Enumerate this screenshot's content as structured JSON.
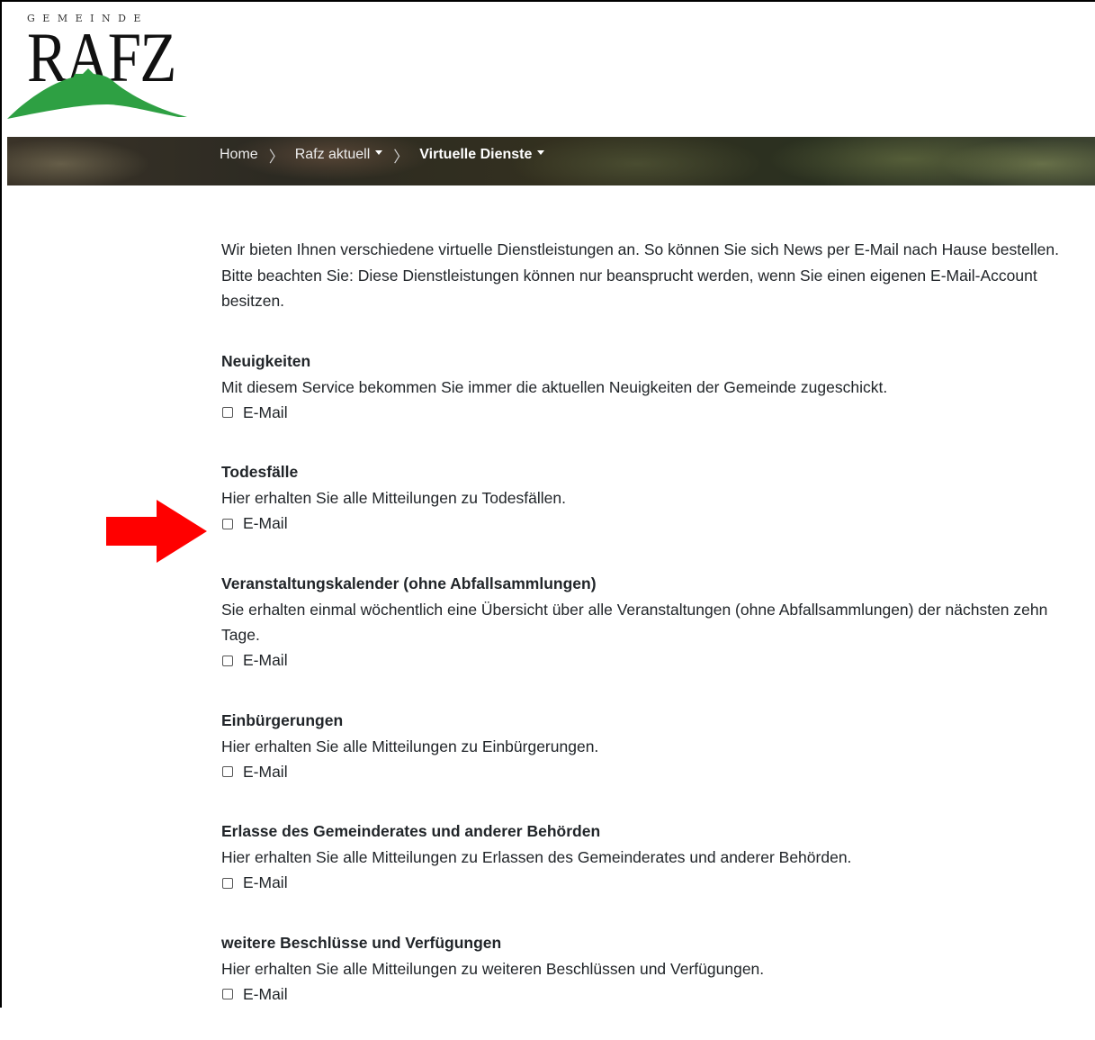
{
  "logo": {
    "top_text": "GEMEINDE",
    "main_text": "RAFZ"
  },
  "breadcrumb": {
    "home": "Home",
    "item1": "Rafz aktuell",
    "current": "Virtuelle Dienste"
  },
  "intro": "Wir bieten Ihnen verschiedene virtuelle Dienstleistungen an. So können Sie sich News per E-Mail nach Hause bestellen. Bitte beachten Sie: Diese Dienstleistungen können nur beansprucht werden, wenn Sie einen eigenen E-Mail-Account besitzen.",
  "services": [
    {
      "title": "Neuigkeiten",
      "description": "Mit diesem Service bekommen Sie immer die aktuellen Neuigkeiten der Gemeinde zugeschickt.",
      "checkbox_label": "E-Mail"
    },
    {
      "title": "Todesfälle",
      "description": "Hier erhalten Sie alle Mitteilungen zu Todesfällen.",
      "checkbox_label": "E-Mail"
    },
    {
      "title": "Veranstaltungskalender (ohne Abfallsammlungen)",
      "description": "Sie erhalten einmal wöchentlich eine Übersicht über alle Veranstaltungen (ohne Abfallsammlungen) der nächsten zehn Tage.",
      "checkbox_label": "E-Mail"
    },
    {
      "title": "Einbürgerungen",
      "description": "Hier erhalten Sie alle Mitteilungen zu Einbürgerungen.",
      "checkbox_label": "E-Mail"
    },
    {
      "title": "Erlasse des Gemeinderates und anderer Behörden",
      "description": "Hier erhalten Sie alle Mitteilungen zu Erlassen des Gemeinderates und anderer Behörden.",
      "checkbox_label": "E-Mail"
    },
    {
      "title": "weitere Beschlüsse und Verfügungen",
      "description": "Hier erhalten Sie alle Mitteilungen zu weiteren Beschlüssen und Verfügungen.",
      "checkbox_label": "E-Mail"
    }
  ],
  "colors": {
    "logo_green": "#2ea043",
    "arrow_red": "#ff0000"
  },
  "annotation": {
    "arrow_icon": "red-arrow-right-icon"
  }
}
